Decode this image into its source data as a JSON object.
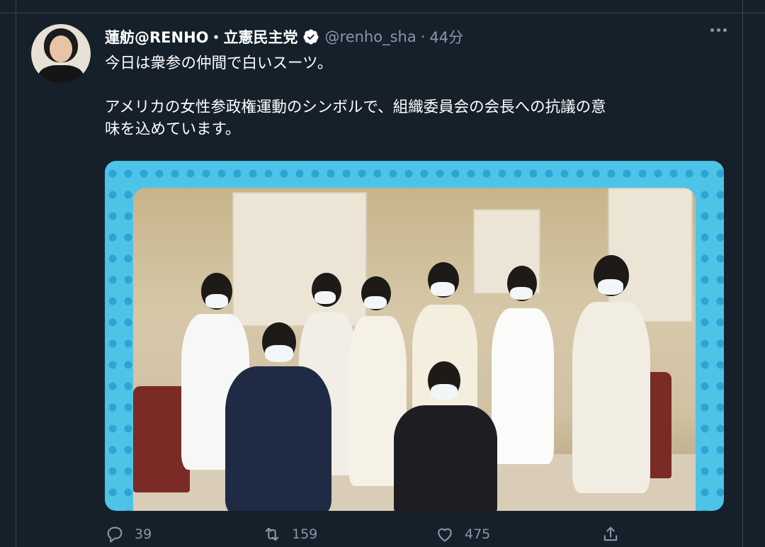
{
  "tweet": {
    "author_name": "蓮舫@RENHO・立憲民主党",
    "handle": "@renho_sha",
    "separator": "·",
    "time": "44分",
    "text_line1": "今日は衆参の仲間で白いスーツ。",
    "text_line2": "アメリカの女性参政権運動のシンボルで、組織委員会の会長への抗議の意",
    "text_line3": "味を込めています。",
    "verified": true
  },
  "actions": {
    "reply_count": "39",
    "retweet_count": "159",
    "like_count": "475"
  },
  "colors": {
    "background": "#15202b",
    "muted_text": "#8899a6",
    "divider": "#38444d",
    "media_frame": "#4ec3e8",
    "verified_badge": "#ffffff"
  },
  "icons": [
    "verified-icon",
    "more-icon",
    "reply-icon",
    "retweet-icon",
    "like-icon",
    "share-icon"
  ]
}
